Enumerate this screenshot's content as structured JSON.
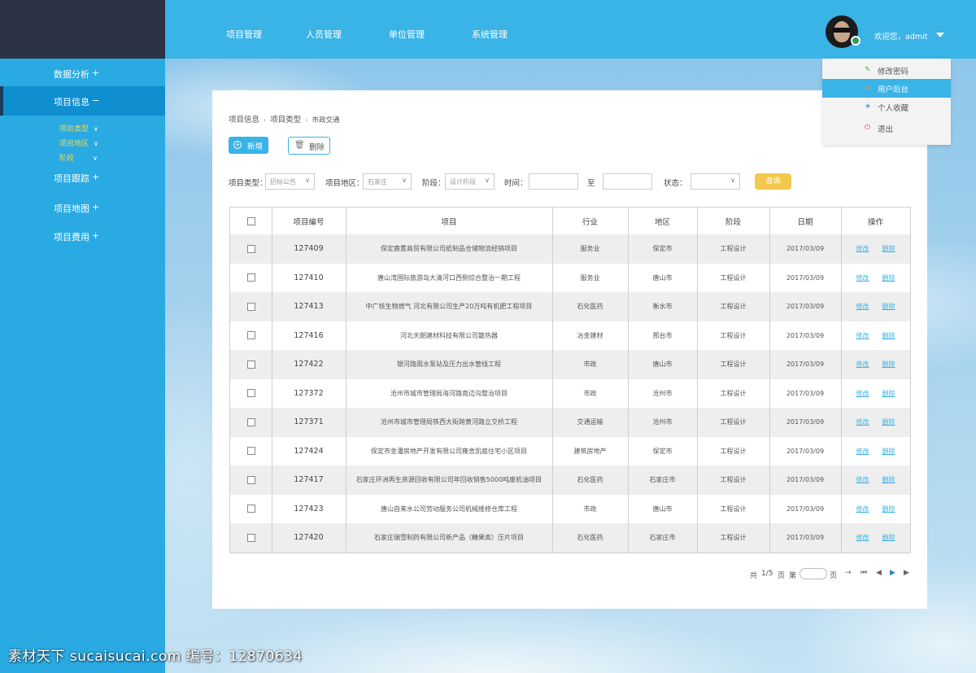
{
  "topnav": [
    "项目管理",
    "人员管理",
    "单位管理",
    "系统管理"
  ],
  "user": {
    "welcome": "欢迎您，admit"
  },
  "user_menu": [
    {
      "icon": "✎",
      "label": "修改密码",
      "icon_color": "#4caf50"
    },
    {
      "icon": "⌂",
      "label": "用户后台",
      "icon_color": "#f0a030",
      "active": true
    },
    {
      "icon": "★",
      "label": "个人收藏",
      "icon_color": "#3ab3e6"
    },
    {
      "icon": "⏻",
      "label": "退出",
      "icon_color": "#e05050"
    }
  ],
  "sidebar": {
    "items": [
      {
        "label": "数据分析",
        "sign": "+"
      },
      {
        "label": "项目信息",
        "sign": "−",
        "active": true
      },
      {
        "label": "项目跟踪",
        "sign": "+"
      },
      {
        "label": "项目地图",
        "sign": "+"
      },
      {
        "label": "项目费用",
        "sign": "+"
      }
    ],
    "subitems": [
      "项目类型",
      "项目地区",
      "阶段"
    ]
  },
  "breadcrumb": [
    "项目信息",
    "项目类型",
    "市政交通"
  ],
  "toolbar": {
    "add_label": "新增",
    "delete_label": "删除"
  },
  "filters": {
    "type_label": "项目类型：",
    "type_value": "招标公告",
    "region_label": "项目地区：",
    "region_value": "石家庄",
    "stage_label": "阶段：",
    "stage_value": "设计阶段",
    "time_label": "时间：",
    "to_label": "至",
    "status_label": "状态：",
    "status_value": "",
    "query_label": "查询"
  },
  "table": {
    "headers": [
      "项目编号",
      "项目",
      "行业",
      "地区",
      "阶段",
      "日期",
      "操作"
    ],
    "edit_label": "修改",
    "delete_label": "删除",
    "rows": [
      {
        "code": "127409",
        "project": "保定鹿置商贸有限公司纸制品仓储物流经销项目",
        "industry": "服务业",
        "region": "保定市",
        "stage": "工程设计",
        "date": "2017/03/09"
      },
      {
        "code": "127410",
        "project": "唐山湾国际旅游岛大清河口西侧综合整治一期工程",
        "industry": "服务业",
        "region": "唐山市",
        "stage": "工程设计",
        "date": "2017/03/09"
      },
      {
        "code": "127413",
        "project": "中广核生物燃气 河北有限公司生产20万吨有机肥工程项目",
        "industry": "石化医药",
        "region": "衡水市",
        "stage": "工程设计",
        "date": "2017/03/09"
      },
      {
        "code": "127416",
        "project": "河北天朗建材科技有限公司散热器",
        "industry": "冶金建材",
        "region": "邢台市",
        "stage": "工程设计",
        "date": "2017/03/09"
      },
      {
        "code": "127422",
        "project": "银河路雨水泵站及压力出水管线工程",
        "industry": "市政",
        "region": "唐山市",
        "stage": "工程设计",
        "date": "2017/03/09"
      },
      {
        "code": "127372",
        "project": "沧州市城市管理局海河路南边沟整治项目",
        "industry": "市政",
        "region": "沧州市",
        "stage": "工程设计",
        "date": "2017/03/09"
      },
      {
        "code": "127371",
        "project": "沧州市城市管理局铁西大街跨黄河路立交桥工程",
        "industry": "交通运输",
        "region": "沧州市",
        "stage": "工程设计",
        "date": "2017/03/09"
      },
      {
        "code": "127424",
        "project": "保定市金潘房地产开发有限公司雍舍凯庭住宅小区项目",
        "industry": "建筑房地产",
        "region": "保定市",
        "stage": "工程设计",
        "date": "2017/03/09"
      },
      {
        "code": "127417",
        "project": "石家庄环洲再生资源回收有限公司年回收销售5000吨废机油项目",
        "industry": "石化医药",
        "region": "石家庄市",
        "stage": "工程设计",
        "date": "2017/03/09"
      },
      {
        "code": "127423",
        "project": "唐山自来水公司劳动服务公司机械维修仓库工程",
        "industry": "市政",
        "region": "唐山市",
        "stage": "工程设计",
        "date": "2017/03/09"
      },
      {
        "code": "127420",
        "project": "石家庄瑞雪制药有限公司新产品（糖果类）压片项目",
        "industry": "石化医药",
        "region": "石家庄市",
        "stage": "工程设计",
        "date": "2017/03/09"
      }
    ]
  },
  "pagination": {
    "total_prefix": "共",
    "pages": "1/5",
    "page_word": "页",
    "goto_prefix": "第",
    "goto_suffix": "页"
  },
  "watermark": "素材天下 sucaisucai.com  编号：12870634"
}
